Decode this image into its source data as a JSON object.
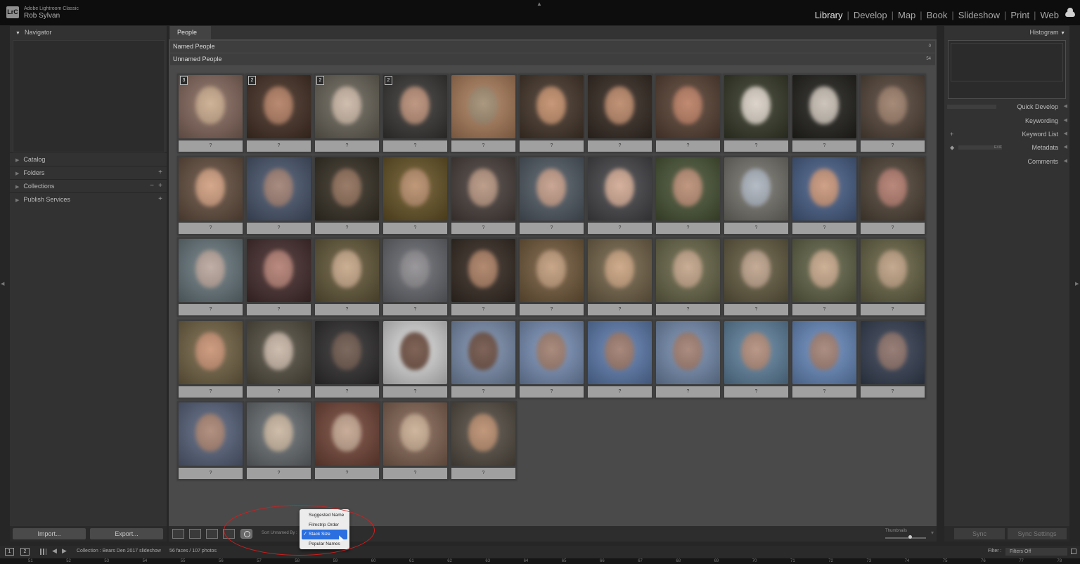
{
  "app": {
    "product_name": "Adobe Lightroom Classic",
    "logo_text": "LrC",
    "user": "Rob Sylvan"
  },
  "modules": [
    "Library",
    "Develop",
    "Map",
    "Book",
    "Slideshow",
    "Print",
    "Web"
  ],
  "active_module": "Library",
  "left_panel": {
    "navigator": "Navigator",
    "sections": [
      "Catalog",
      "Folders",
      "Collections",
      "Publish Services"
    ],
    "import_label": "Import...",
    "export_label": "Export..."
  },
  "center": {
    "tab": "People",
    "named_people": {
      "label": "Named People",
      "count": "0"
    },
    "unnamed_people": {
      "label": "Unnamed People",
      "count": "54"
    },
    "face_label": "?",
    "faces": [
      {
        "badge": "3",
        "color": "#c9a98a",
        "bg": "#8d6f63"
      },
      {
        "badge": "2",
        "color": "#b07a5e",
        "bg": "#4a3428"
      },
      {
        "badge": "2",
        "color": "#c9b5a3",
        "bg": "#6f6a5e"
      },
      {
        "badge": "2",
        "color": "#b68a72",
        "bg": "#3c3a38"
      },
      {
        "badge": "",
        "color": "#a08a6e",
        "bg": "#b48460"
      },
      {
        "badge": "",
        "color": "#c08a66",
        "bg": "#4a3a2e"
      },
      {
        "badge": "",
        "color": "#b88464",
        "bg": "#3a2e26"
      },
      {
        "badge": "",
        "color": "#b87a5e",
        "bg": "#5e4638"
      },
      {
        "badge": "",
        "color": "#d8cfc4",
        "bg": "#3a3e2c"
      },
      {
        "badge": "",
        "color": "#c6bdb2",
        "bg": "#25241f"
      },
      {
        "badge": "",
        "color": "#9a7b66",
        "bg": "#5a4a3e"
      },
      {
        "badge": "",
        "color": "#cf9c7c",
        "bg": "#6b5444"
      },
      {
        "badge": "",
        "color": "#9c7c70",
        "bg": "#4e5c74"
      },
      {
        "badge": "",
        "color": "#8c6a54",
        "bg": "#3b3428"
      },
      {
        "badge": "",
        "color": "#b68a66",
        "bg": "#6e5a2a"
      },
      {
        "badge": "",
        "color": "#b4917c",
        "bg": "#4e4440"
      },
      {
        "badge": "",
        "color": "#c29a86",
        "bg": "#56606a"
      },
      {
        "badge": "",
        "color": "#cfa690",
        "bg": "#4a4a4e"
      },
      {
        "badge": "",
        "color": "#b88a70",
        "bg": "#4e5a3a"
      },
      {
        "badge": "",
        "color": "#aab2bc",
        "bg": "#7c7a72"
      },
      {
        "badge": "",
        "color": "#c89478",
        "bg": "#4e6690"
      },
      {
        "badge": "",
        "color": "#b0786a",
        "bg": "#56493c"
      },
      {
        "badge": "",
        "color": "#b8a49a",
        "bg": "#6e7e84"
      },
      {
        "badge": "",
        "color": "#b07a6e",
        "bg": "#4a3030"
      },
      {
        "badge": "",
        "color": "#c4a484",
        "bg": "#6a5e3e"
      },
      {
        "badge": "",
        "color": "#8c8a8e",
        "bg": "#6e7076"
      },
      {
        "badge": "",
        "color": "#a87a5e",
        "bg": "#3a2e26"
      },
      {
        "badge": "",
        "color": "#c09a78",
        "bg": "#7a6040"
      },
      {
        "badge": "",
        "color": "#c8a07c",
        "bg": "#7a6a4e"
      },
      {
        "badge": "",
        "color": "#c2a286",
        "bg": "#706e4e"
      },
      {
        "badge": "",
        "color": "#bca088",
        "bg": "#6a6246"
      },
      {
        "badge": "",
        "color": "#c6a688",
        "bg": "#686a4c"
      },
      {
        "badge": "",
        "color": "#bc9e80",
        "bg": "#6e6a4a"
      },
      {
        "badge": "",
        "color": "#c89070",
        "bg": "#7a6a4a"
      },
      {
        "badge": "",
        "color": "#c6b4a4",
        "bg": "#5a5446"
      },
      {
        "badge": "",
        "color": "#6a5448",
        "bg": "#343232"
      },
      {
        "badge": "",
        "color": "#6e4e40",
        "bg": "#e2e2e2"
      },
      {
        "badge": "",
        "color": "#6c4e42",
        "bg": "#8296b6"
      },
      {
        "badge": "",
        "color": "#9e7c6c",
        "bg": "#8098c0"
      },
      {
        "badge": "",
        "color": "#9c786a",
        "bg": "#6484b8"
      },
      {
        "badge": "",
        "color": "#a07c6e",
        "bg": "#7c94b8"
      },
      {
        "badge": "",
        "color": "#b08a78",
        "bg": "#668aa8"
      },
      {
        "badge": "",
        "color": "#a07e72",
        "bg": "#6e92c8"
      },
      {
        "badge": "",
        "color": "#8a6e66",
        "bg": "#3a4458"
      },
      {
        "badge": "",
        "color": "#a88270",
        "bg": "#5e6a84"
      },
      {
        "badge": "",
        "color": "#c8b49e",
        "bg": "#6e7478"
      },
      {
        "badge": "",
        "color": "#c2a28c",
        "bg": "#7a4a3c"
      },
      {
        "badge": "",
        "color": "#c8ab90",
        "bg": "#8a6a58"
      },
      {
        "badge": "",
        "color": "#b88a6a",
        "bg": "#5a5248"
      }
    ]
  },
  "toolbar": {
    "sort_label": "Sort Unnamed By :",
    "thumbnails_label": "Thumbnails"
  },
  "sort_menu": {
    "items": [
      "Suggested Name",
      "Filmstrip Order",
      "Stack Size",
      "Popular Names"
    ],
    "selected": "Stack Size",
    "check": "✓"
  },
  "right_panel": {
    "histogram": "Histogram",
    "rows": [
      "Quick Develop",
      "Keywording",
      "Keyword List",
      "Metadata",
      "Comments"
    ],
    "metadata_preset": "EXIF",
    "sync_label": "Sync",
    "sync_settings_label": "Sync Settings"
  },
  "filmbar": {
    "screen1": "1",
    "screen2": "2",
    "collection": "Collection : Bears Den 2017 slideshow",
    "faces_count": "56 faces / 107 photos",
    "filter_label": "Filter :",
    "filter_value": "Filters Off"
  },
  "filmstrip_numbers": [
    "51",
    "52",
    "53",
    "54",
    "55",
    "56",
    "57",
    "58",
    "59",
    "60",
    "61",
    "62",
    "63",
    "64",
    "65",
    "66",
    "67",
    "68",
    "69",
    "70",
    "71",
    "72",
    "73",
    "74",
    "75",
    "76",
    "77",
    "78"
  ]
}
